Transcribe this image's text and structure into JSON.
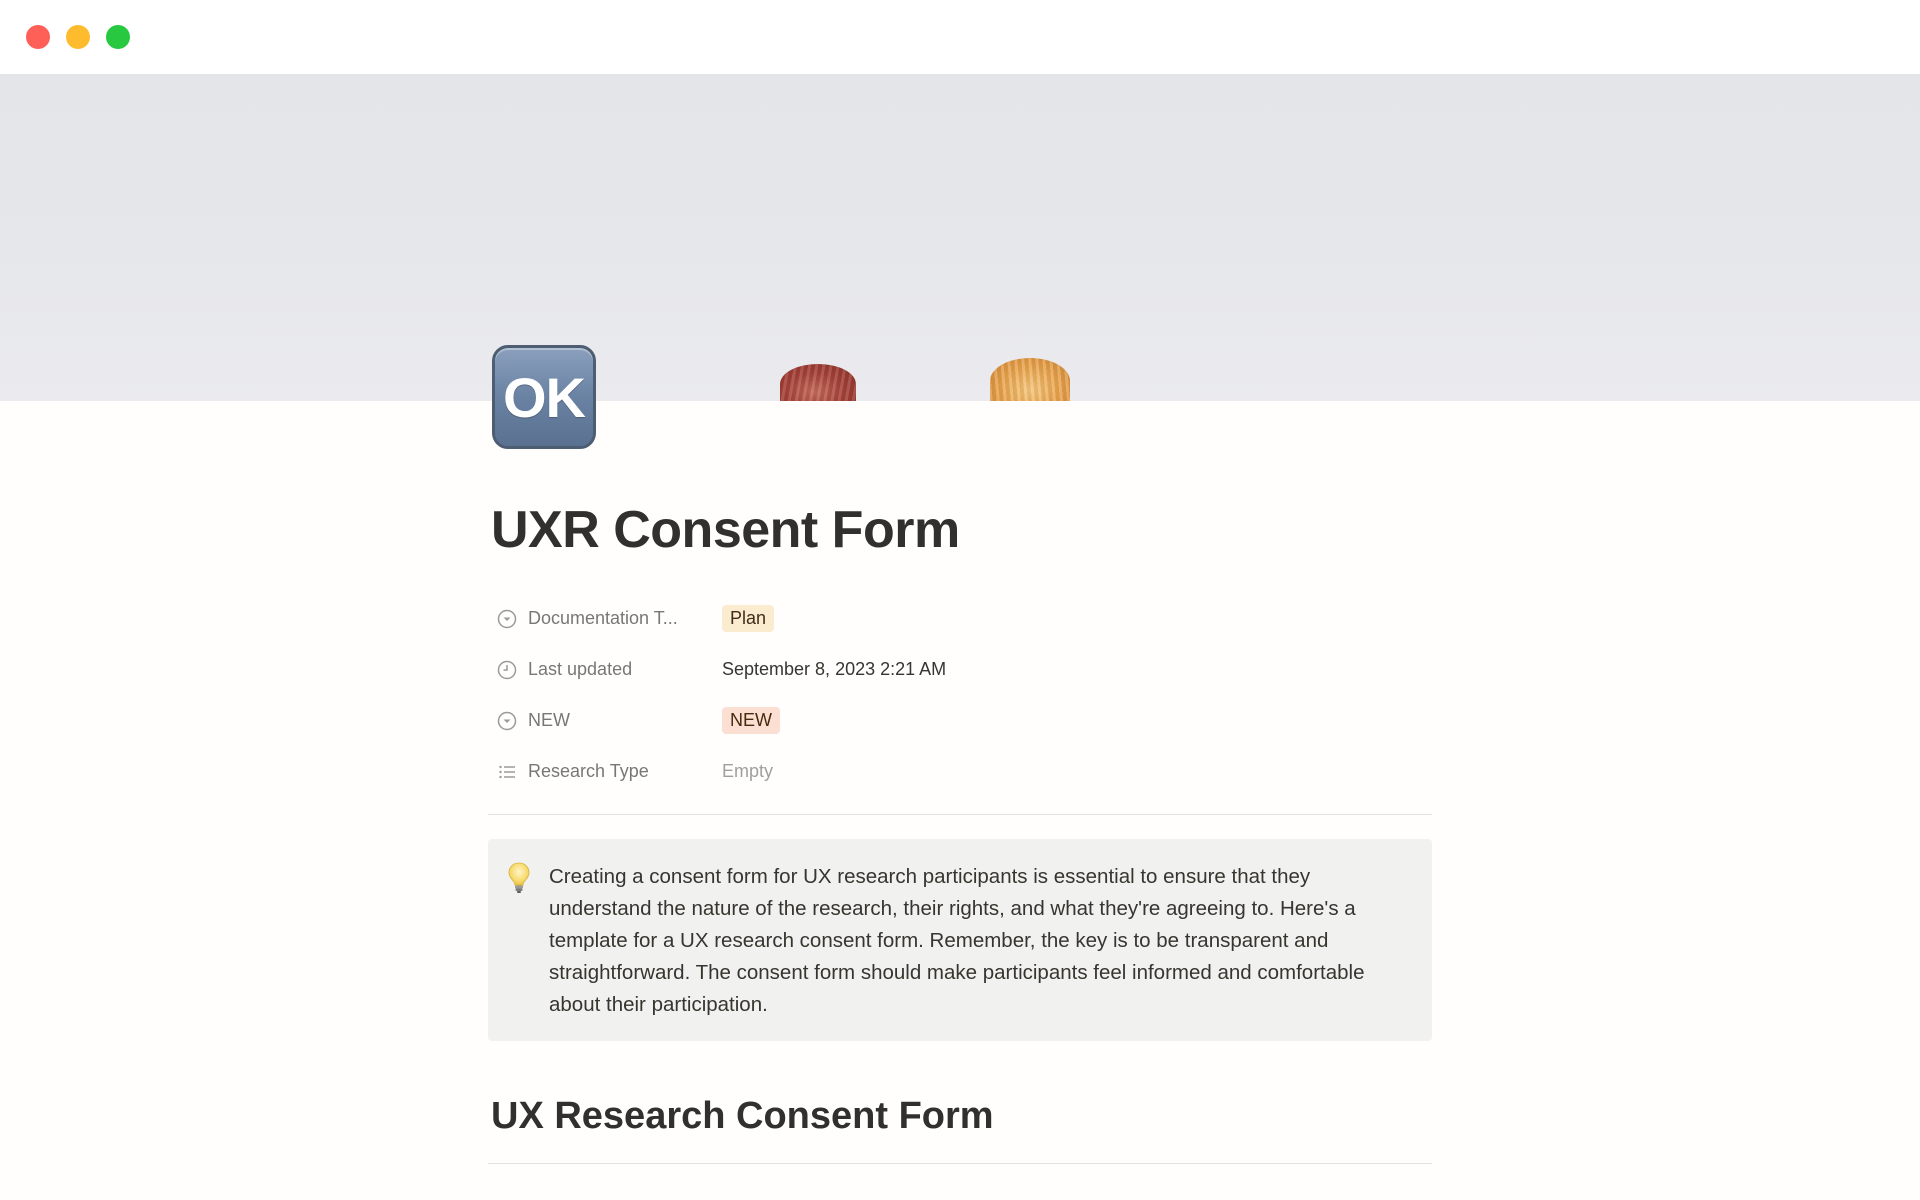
{
  "window": {
    "controls": [
      "close",
      "minimize",
      "maximize"
    ]
  },
  "cover": {
    "description_colors": {
      "background": "#e5e6ea"
    }
  },
  "page": {
    "icon_text": "OK",
    "title": "UXR Consent Form"
  },
  "properties": [
    {
      "icon": "select-icon",
      "label": "Documentation T...",
      "value": "Plan",
      "kind": "tag",
      "color": "#fbeccf"
    },
    {
      "icon": "clock-icon",
      "label": "Last updated",
      "value": "September 8, 2023 2:21 AM",
      "kind": "text"
    },
    {
      "icon": "select-icon",
      "label": "NEW",
      "value": "NEW",
      "kind": "tag",
      "color": "#fbdfd2"
    },
    {
      "icon": "list-icon",
      "label": "Research Type",
      "value": "Empty",
      "kind": "empty"
    }
  ],
  "callout": {
    "icon": "lightbulb-icon",
    "text": "Creating a consent form for UX research participants is essential to ensure that they understand the nature of the research, their rights, and what they're agreeing to. Here's a template for a UX research consent form. Remember, the key is to be transparent and straightforward. The consent form should make participants feel informed and comfortable about their participation."
  },
  "section": {
    "heading": "UX Research Consent Form"
  }
}
